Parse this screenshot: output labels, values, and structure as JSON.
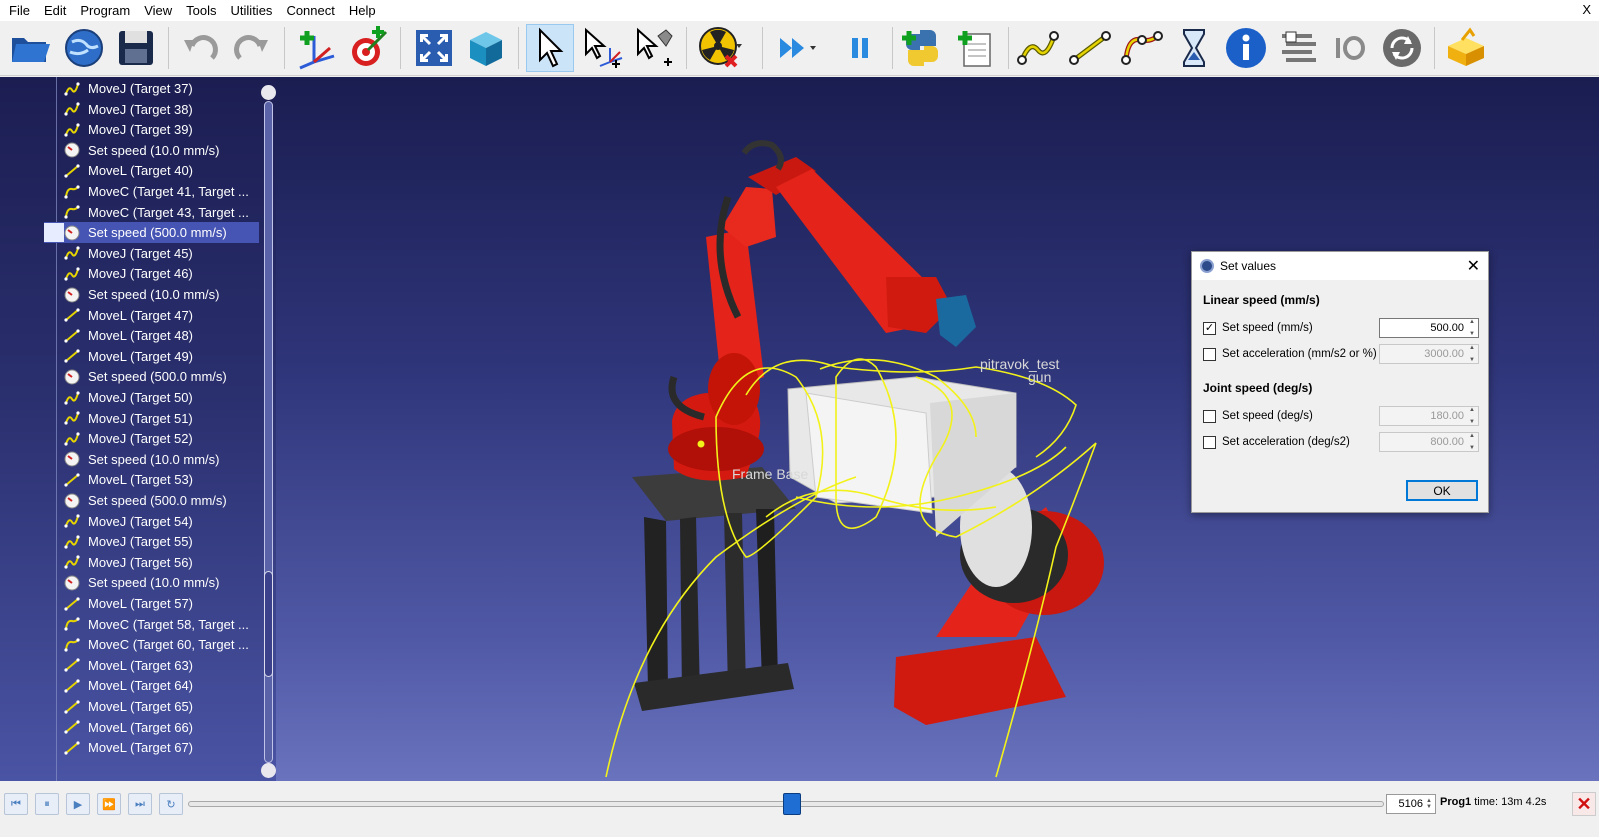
{
  "menu": {
    "items": [
      "File",
      "Edit",
      "Program",
      "View",
      "Tools",
      "Utilities",
      "Connect",
      "Help"
    ],
    "close": "X"
  },
  "toolbar": {
    "buttons": [
      "open-folder-icon",
      "globe-icon",
      "save-icon",
      "undo-icon",
      "redo-icon",
      "add-reference-frame-icon",
      "add-target-icon",
      "fit-all-icon",
      "iso-view-icon",
      "select-icon",
      "move-reference-icon",
      "move-tool-icon",
      "collision-check-icon",
      "fast-simulation-icon",
      "pause-icon",
      "python-icon",
      "new-program-icon",
      "movej-instruction-icon",
      "movel-instruction-icon",
      "movec-instruction-icon",
      "pause-instruction-icon",
      "info-icon",
      "program-call-icon",
      "io-icon",
      "refresh-icon",
      "export-icon"
    ],
    "active": "select-icon"
  },
  "tree": {
    "items": [
      {
        "label": "MoveJ (Target 37)",
        "icon": "movej-icon"
      },
      {
        "label": "MoveJ (Target 38)",
        "icon": "movej-icon"
      },
      {
        "label": "MoveJ (Target 39)",
        "icon": "movej-icon"
      },
      {
        "label": "Set speed (10.0 mm/s)",
        "icon": "speed-icon"
      },
      {
        "label": "MoveL (Target 40)",
        "icon": "movel-icon"
      },
      {
        "label": "MoveC (Target 41, Target ...",
        "icon": "movec-icon"
      },
      {
        "label": "MoveC (Target 43, Target ...",
        "icon": "movec-icon"
      },
      {
        "label": "Set speed (500.0 mm/s)",
        "icon": "speed-icon",
        "selected": true
      },
      {
        "label": "MoveJ (Target 45)",
        "icon": "movej-icon"
      },
      {
        "label": "MoveJ (Target 46)",
        "icon": "movej-icon"
      },
      {
        "label": "Set speed (10.0 mm/s)",
        "icon": "speed-icon"
      },
      {
        "label": "MoveL (Target 47)",
        "icon": "movel-icon"
      },
      {
        "label": "MoveL (Target 48)",
        "icon": "movel-icon"
      },
      {
        "label": "MoveL (Target 49)",
        "icon": "movel-icon"
      },
      {
        "label": "Set speed (500.0 mm/s)",
        "icon": "speed-icon"
      },
      {
        "label": "MoveJ (Target 50)",
        "icon": "movej-icon"
      },
      {
        "label": "MoveJ (Target 51)",
        "icon": "movej-icon"
      },
      {
        "label": "MoveJ (Target 52)",
        "icon": "movej-icon"
      },
      {
        "label": "Set speed (10.0 mm/s)",
        "icon": "speed-icon"
      },
      {
        "label": "MoveL (Target 53)",
        "icon": "movel-icon"
      },
      {
        "label": "Set speed (500.0 mm/s)",
        "icon": "speed-icon"
      },
      {
        "label": "MoveJ (Target 54)",
        "icon": "movej-icon"
      },
      {
        "label": "MoveJ (Target 55)",
        "icon": "movej-icon"
      },
      {
        "label": "MoveJ (Target 56)",
        "icon": "movej-icon"
      },
      {
        "label": "Set speed (10.0 mm/s)",
        "icon": "speed-icon"
      },
      {
        "label": "MoveL (Target 57)",
        "icon": "movel-icon"
      },
      {
        "label": "MoveC (Target 58, Target ...",
        "icon": "movec-icon"
      },
      {
        "label": "MoveC (Target 60, Target ...",
        "icon": "movec-icon"
      },
      {
        "label": "MoveL (Target 63)",
        "icon": "movel-icon"
      },
      {
        "label": "MoveL (Target 64)",
        "icon": "movel-icon"
      },
      {
        "label": "MoveL (Target 65)",
        "icon": "movel-icon"
      },
      {
        "label": "MoveL (Target 66)",
        "icon": "movel-icon"
      },
      {
        "label": "MoveL (Target 67)",
        "icon": "movel-icon"
      }
    ]
  },
  "viewport": {
    "labels": {
      "tool_top": "pitravok_test",
      "tool_bottom": "gun",
      "frame": "Frame Base"
    },
    "colors": {
      "robot": "#e01a10",
      "path": "#f2f21a",
      "stand": "#2a2a2a",
      "part": "#e8e8e8"
    }
  },
  "dialog": {
    "title": "Set values",
    "close": "✕",
    "linear_section": "Linear speed (mm/s)",
    "joint_section": "Joint speed (deg/s)",
    "rows": {
      "lin_speed": {
        "label": "Set speed (mm/s)",
        "checked": true,
        "value": "500.00"
      },
      "lin_accel": {
        "label": "Set acceleration (mm/s2 or %)",
        "checked": false,
        "value": "3000.00"
      },
      "joint_speed": {
        "label": "Set speed (deg/s)",
        "checked": false,
        "value": "180.00"
      },
      "joint_accel": {
        "label": "Set acceleration (deg/s2)",
        "checked": false,
        "value": "800.00"
      }
    },
    "ok": "OK"
  },
  "bottom": {
    "frame_value": "5106",
    "program": "Prog1",
    "time_text": "time: 13m 4.2s",
    "slider_fraction": 0.505
  }
}
